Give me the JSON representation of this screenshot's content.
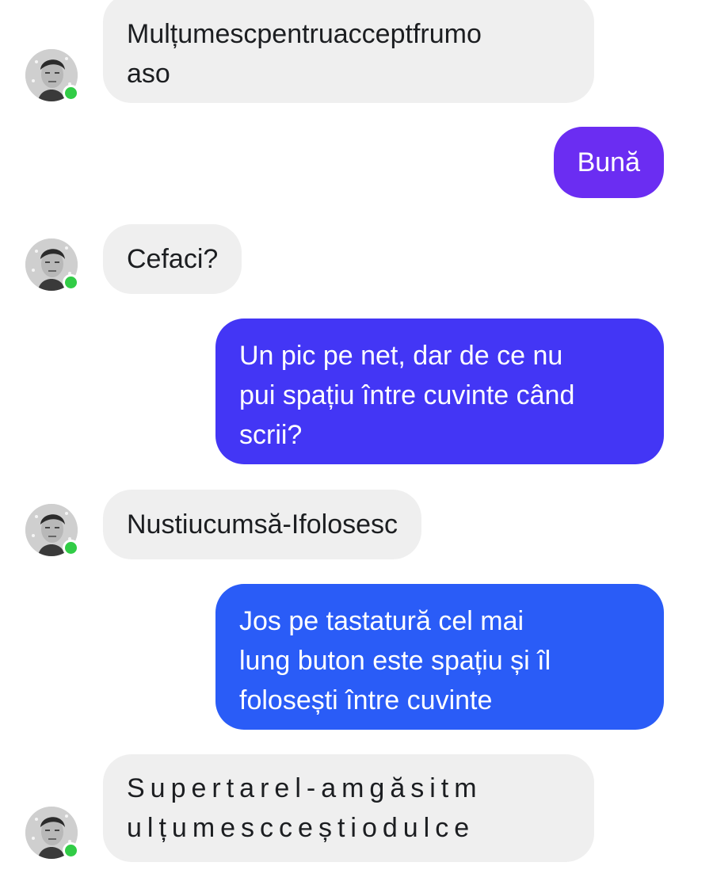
{
  "conversation": {
    "messages": [
      {
        "from": "contact",
        "text": "Mulțumescpentruacceptfrumo aso",
        "lines": [
          "Mulțumescpentruacceptfrumo",
          "aso"
        ]
      },
      {
        "from": "me",
        "text": "Bună"
      },
      {
        "from": "contact",
        "text": "Cefaci?"
      },
      {
        "from": "me",
        "text": "Un pic pe net, dar de ce nu pui spațiu între cuvinte când scrii?",
        "lines": [
          "Un pic pe net, dar de ce nu",
          "pui spațiu între cuvinte când",
          "scrii?"
        ]
      },
      {
        "from": "contact",
        "text": "Nustiucumsă-Ifolosesc"
      },
      {
        "from": "me",
        "text": "Jos pe tastatură cel mai lung buton este spațiu și îl folosești între cuvinte",
        "lines": [
          "Jos pe tastatură cel mai",
          "lung buton este spațiu și îl",
          "folosești între cuvinte"
        ]
      },
      {
        "from": "contact",
        "text": "Supertarel-amgăsitm ulțumescceștiodulce",
        "lines": [
          "Supertarel-amgăsitm",
          "ulțumescceștiodulce"
        ]
      }
    ]
  },
  "contact": {
    "avatar_icon": "contact-avatar-photo",
    "status": "online",
    "status_color": "#31cc46"
  },
  "colors": {
    "incoming_bubble": "#efefef",
    "outgoing_gradient": [
      "#6d2cf2",
      "#4536f5",
      "#2a52f8",
      "#1877f2"
    ]
  }
}
